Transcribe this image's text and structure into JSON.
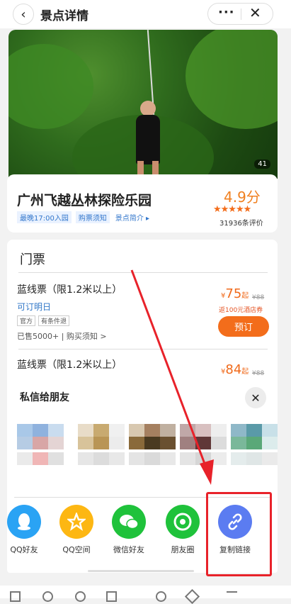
{
  "header": {
    "title": "景点详情",
    "back_icon": "‹",
    "more_icon": "···",
    "close_icon": "✕"
  },
  "hero": {
    "photo_count": "41"
  },
  "attraction": {
    "name": "广州飞越丛林探险乐园",
    "tags": [
      "最晚17:00入园",
      "购票须知"
    ],
    "intro_link": "景点简介 ▸",
    "score": "4.9分",
    "stars": "★★★★★",
    "review_count": "31936条评价"
  },
  "tickets": {
    "heading": "门票",
    "items": [
      {
        "name": "蓝线票（限1.2米以上）",
        "availability": "可订明日",
        "badges": [
          "官方",
          "有条件退"
        ],
        "sold": "已售5000+ | 购买须知 >",
        "price": "75",
        "price_suffix": "起",
        "original": "¥88",
        "coupon": "返100元酒店券",
        "book": "预订"
      },
      {
        "name": "蓝线票（限1.2米以上）",
        "price": "84",
        "price_suffix": "起",
        "original": "¥88"
      }
    ]
  },
  "share_sheet": {
    "title": "私信给朋友",
    "close_icon": "✕",
    "options": [
      {
        "label": "QQ好友",
        "icon": "qq-icon",
        "color": "#2aa3f4"
      },
      {
        "label": "QQ空间",
        "icon": "qzone-icon",
        "color": "#fdb713"
      },
      {
        "label": "微信好友",
        "icon": "wechat-icon",
        "color": "#1fc23b"
      },
      {
        "label": "朋友圈",
        "icon": "moments-icon",
        "color": "#1fc23b"
      },
      {
        "label": "复制链接",
        "icon": "link-icon",
        "color": "#5b7cf1"
      }
    ]
  },
  "colors": {
    "accent": "#f36d1b",
    "link": "#2f76c7",
    "annotation": "#e8222a"
  }
}
